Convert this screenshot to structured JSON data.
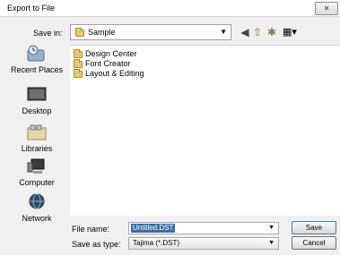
{
  "window": {
    "title": "Export to File",
    "close_icon": "close-icon"
  },
  "save_in": {
    "label": "Save in:",
    "value": "Sample"
  },
  "toolbar": {
    "icons": [
      "back-icon",
      "up-folder-icon",
      "new-folder-icon",
      "views-menu-icon"
    ]
  },
  "places": [
    {
      "label": "Recent Places",
      "icon": "recent-places-icon"
    },
    {
      "label": "Desktop",
      "icon": "desktop-icon"
    },
    {
      "label": "Libraries",
      "icon": "libraries-icon"
    },
    {
      "label": "Computer",
      "icon": "computer-icon"
    },
    {
      "label": "Network",
      "icon": "network-icon"
    }
  ],
  "files": [
    {
      "name": "Design Center"
    },
    {
      "name": "Font Creator"
    },
    {
      "name": "Layout & Editing"
    }
  ],
  "file_name": {
    "label": "File name:",
    "value": "Untitled.DST"
  },
  "save_as_type": {
    "label": "Save as type:",
    "value": "Tajima (*.DST)"
  },
  "buttons": {
    "save": "Save",
    "cancel": "Cancel"
  }
}
